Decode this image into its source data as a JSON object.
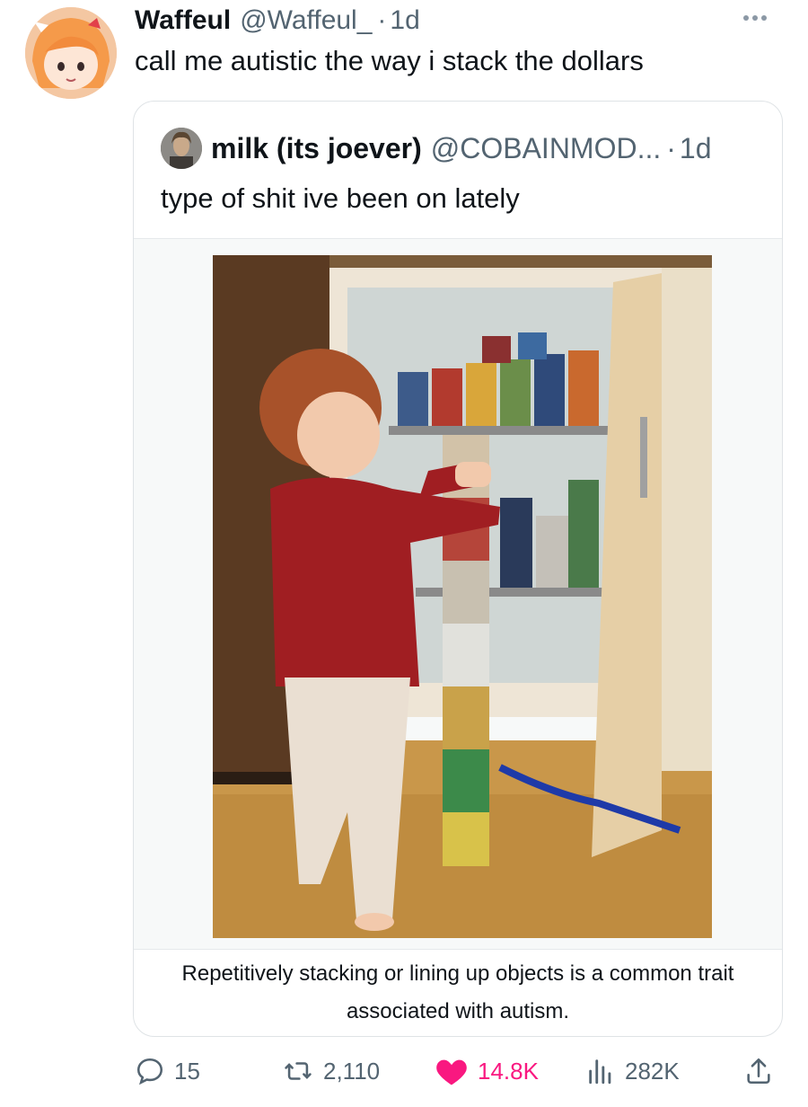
{
  "tweet": {
    "author_name": "Waffeul",
    "author_handle": "@Waffeul_",
    "separator": "·",
    "time": "1d",
    "text": "call me autistic the way i stack the dollars",
    "avatar_icon": "anime-girl-avatar"
  },
  "quoted": {
    "author_name": "milk (its joever)",
    "author_handle": "@COBAINMOD...",
    "separator": "·",
    "time": "1d",
    "text": "type of shit ive been on lately",
    "image_icon": "toddler-stacking-cans-photo",
    "caption": "Repetitively stacking or lining up objects is a common trait associated with autism."
  },
  "actions": {
    "replies": "15",
    "reposts": "2,110",
    "likes": "14.8K",
    "views": "282K"
  },
  "colors": {
    "text": "#0f1419",
    "muted": "#536471",
    "like": "#f91880",
    "border": "#dfe3e6"
  }
}
